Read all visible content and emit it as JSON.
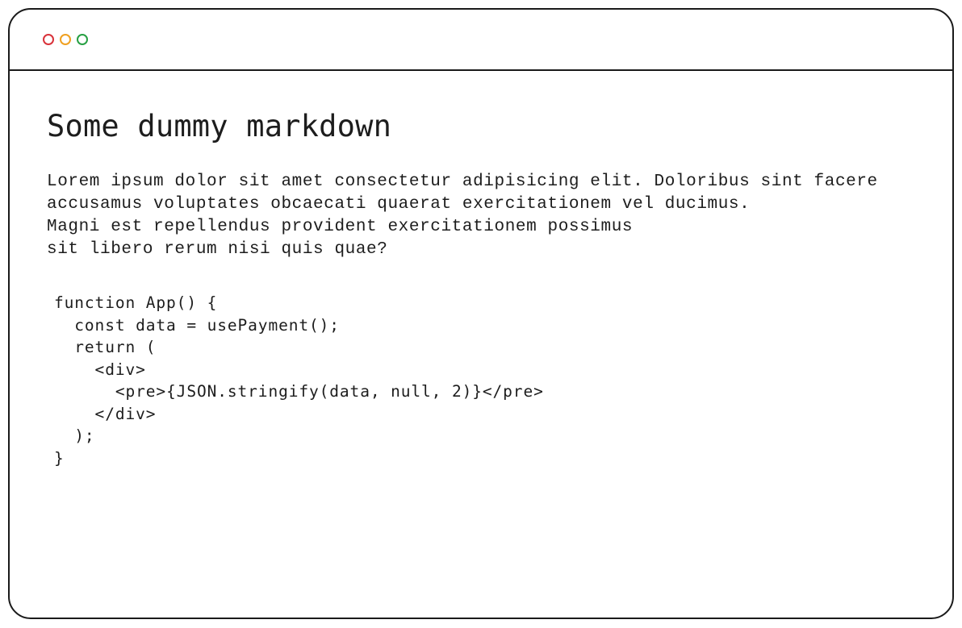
{
  "window": {
    "traffic_lights": {
      "red": "#d9323a",
      "yellow": "#f0a020",
      "green": "#27a043"
    }
  },
  "document": {
    "heading": "Some dummy markdown",
    "paragraph_lines": [
      "Lorem ipsum dolor sit amet consectetur adipisicing elit. Doloribus sint facere",
      "accusamus voluptates obcaecati quaerat exercitationem vel ducimus.",
      "Magni est repellendus provident exercitationem possimus",
      "sit libero rerum nisi quis quae?"
    ],
    "code_lines": [
      "function App() {",
      "  const data = usePayment();",
      "  return (",
      "    <div>",
      "      <pre>{JSON.stringify(data, null, 2)}</pre>",
      "    </div>",
      "  );",
      "}"
    ]
  }
}
